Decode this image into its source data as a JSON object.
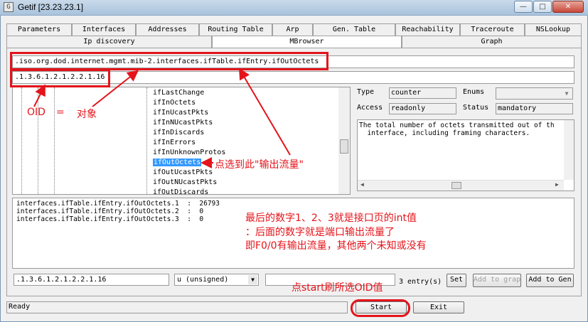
{
  "window": {
    "title": "Getif [23.23.23.1]",
    "minimize": "—",
    "maximize": "□",
    "close": "✕"
  },
  "tabs_row1": [
    "Parameters",
    "Interfaces",
    "Addresses",
    "Routing Table",
    "Arp",
    "Gen. Table",
    "Reachability",
    "Traceroute",
    "NSLookup"
  ],
  "tabs_row2": [
    "Ip discovery",
    "MBrowser",
    "Graph"
  ],
  "mib_path": ".iso.org.dod.internet.mgmt.mib-2.interfaces.ifTable.ifEntry.ifOutOctets",
  "oid": ".1.3.6.1.2.1.2.2.1.16",
  "tree_items": [
    "ifLastChange",
    "ifInOctets",
    "ifInUcastPkts",
    "ifInNUcastPkts",
    "ifInDiscards",
    "ifInErrors",
    "ifInUnknownProtos",
    "ifOutOctets",
    "ifOutUcastPkts",
    "ifOutNUcastPkts",
    "ifOutDiscards"
  ],
  "props": {
    "type_label": "Type",
    "type_value": "counter",
    "enums_label": "Enums",
    "access_label": "Access",
    "access_value": "readonly",
    "status_label": "Status",
    "status_value": "mandatory"
  },
  "description": "The total number of octets transmitted out of th\n  interface, including framing characters.",
  "results": [
    "interfaces.ifTable.ifEntry.ifOutOctets.1  :  26793",
    "interfaces.ifTable.ifEntry.ifOutOctets.2  :  0",
    "interfaces.ifTable.ifEntry.ifOutOctets.3  :  0"
  ],
  "bottom": {
    "oid_value": ".1.3.6.1.2.1.2.2.1.16",
    "type_select": "u (unsigned)",
    "entries": "3 entry(s)",
    "set": "Set",
    "add_graph": "Add to graph",
    "add_gen": "Add to Gen"
  },
  "status": "Ready",
  "start": "Start",
  "exit": "Exit",
  "annotations": {
    "oid_label": "OID",
    "equals": "=",
    "object": "对象",
    "select_here": "点选到此\"输出流量\"",
    "last_digits_1": "最后的数字1、2、3就是接口页的int值",
    "last_digits_2": "：后面的数字就是端口输出流量了",
    "last_digits_3": "即F0/0有输出流量，其他两个未知或没有",
    "click_start": "点start刷所选OID值"
  },
  "colors": {
    "annotation_red": "#e4141b",
    "selection_blue": "#3399ff"
  }
}
